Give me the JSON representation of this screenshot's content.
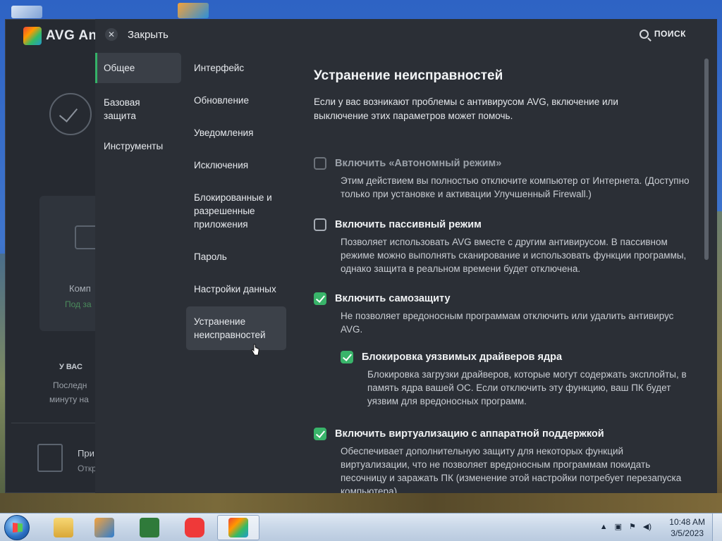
{
  "window": {
    "app_name": "AVG Ant",
    "background": {
      "status_line_1": "Комп",
      "status_line_2": "Под за",
      "section_title": "У ВАС",
      "last_line_1": "Последн",
      "last_line_2": "минуту на",
      "promo_title": "При",
      "promo_sub": "Откр"
    }
  },
  "settings": {
    "close_label": "Закрыть",
    "search_label": "ПОИСК",
    "categories": [
      {
        "label": "Общее",
        "active": true
      },
      {
        "label": "Базовая защита",
        "active": false
      },
      {
        "label": "Инструменты",
        "active": false
      }
    ],
    "subsections": [
      {
        "label": "Интерфейс"
      },
      {
        "label": "Обновление"
      },
      {
        "label": "Уведомления"
      },
      {
        "label": "Исключения"
      },
      {
        "label": "Блокированные и разрешенные приложения"
      },
      {
        "label": "Пароль"
      },
      {
        "label": "Настройки данных"
      },
      {
        "label": "Устранение неисправностей"
      }
    ],
    "content": {
      "title": "Устранение неисправностей",
      "description": "Если у вас возникают проблемы с антивирусом AVG, включение или выключение этих параметров может помочь.",
      "options": [
        {
          "label": "Включить «Автономный режим»",
          "desc": "Этим действием вы полностью отключите компьютер от Интернета. (Доступно только при установке и активации Улучшенный Firewall.)",
          "checked": false,
          "disabled": true
        },
        {
          "label": "Включить пассивный режим",
          "desc": "Позволяет использовать AVG вместе с другим антивирусом. В пассивном режиме можно выполнять сканирование и использовать функции программы, однако защита в реальном времени будет отключена.",
          "checked": false,
          "disabled": false
        },
        {
          "label": "Включить самозащиту",
          "desc": "Не позволяет вредоносным программам отключить или удалить антивирус AVG.",
          "checked": true,
          "disabled": false
        },
        {
          "label": "Блокировка уязвимых драйверов ядра",
          "desc": "Блокировка загрузки драйверов, которые могут содержать эксплойты, в память ядра вашей ОС. Если отключить эту функцию, ваш ПК будет уязвим для вредоносных программ.",
          "checked": true,
          "disabled": false
        },
        {
          "label": "Включить виртуализацию с аппаратной поддержкой",
          "desc": "Обеспечивает дополнительную защиту для некоторых функций виртуализации, что не позволяет вредоносным программам покидать песочницу и заражать ПК (изменение этой настройки потребует перезапуска компьютера).",
          "checked": true,
          "disabled": false
        }
      ]
    }
  },
  "taskbar": {
    "apps": [
      "file-explorer",
      "media-player",
      "csharp-editor",
      "vivaldi-browser",
      "avg-antivirus"
    ],
    "clock_time": "10:48 AM",
    "clock_date": "3/5/2023"
  },
  "colors": {
    "accent_green": "#39b46a",
    "panel_bg": "#2b2f36",
    "main_bg": "#262a31"
  }
}
